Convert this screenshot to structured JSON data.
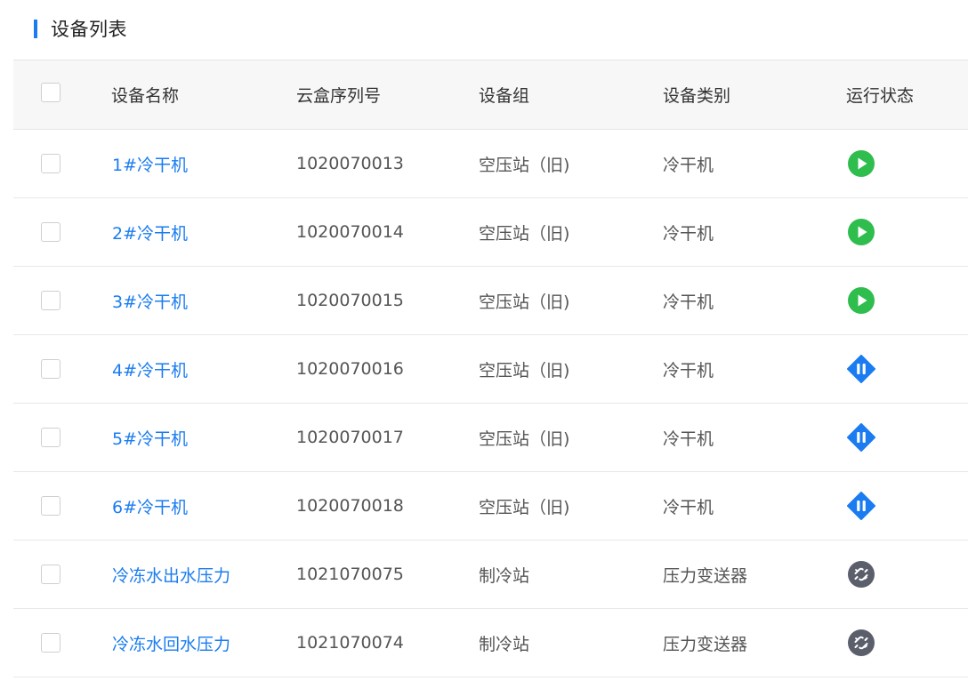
{
  "section": {
    "title": "设备列表",
    "accent_color": "#1a7cf0"
  },
  "table": {
    "columns": {
      "name": "设备名称",
      "serial": "云盒序列号",
      "group": "设备组",
      "category": "设备类别",
      "status": "运行状态"
    },
    "rows": [
      {
        "name": "1#冷干机",
        "serial": "1020070013",
        "group": "空压站（旧)",
        "category": "冷干机",
        "status": "running",
        "status_icon": "play-circle-icon"
      },
      {
        "name": "2#冷干机",
        "serial": "1020070014",
        "group": "空压站（旧)",
        "category": "冷干机",
        "status": "running",
        "status_icon": "play-circle-icon"
      },
      {
        "name": "3#冷干机",
        "serial": "1020070015",
        "group": "空压站（旧)",
        "category": "冷干机",
        "status": "running",
        "status_icon": "play-circle-icon"
      },
      {
        "name": "4#冷干机",
        "serial": "1020070016",
        "group": "空压站（旧)",
        "category": "冷干机",
        "status": "paused",
        "status_icon": "pause-diamond-icon"
      },
      {
        "name": "5#冷干机",
        "serial": "1020070017",
        "group": "空压站（旧)",
        "category": "冷干机",
        "status": "paused",
        "status_icon": "pause-diamond-icon"
      },
      {
        "name": "6#冷干机",
        "serial": "1020070018",
        "group": "空压站（旧)",
        "category": "冷干机",
        "status": "paused",
        "status_icon": "pause-diamond-icon"
      },
      {
        "name": "冷冻水出水压力",
        "serial": "1021070075",
        "group": "制冷站",
        "category": "压力变送器",
        "status": "disconnected",
        "status_icon": "disconnected-link-icon"
      },
      {
        "name": "冷冻水回水压力",
        "serial": "1021070074",
        "group": "制冷站",
        "category": "压力变送器",
        "status": "disconnected",
        "status_icon": "disconnected-link-icon"
      }
    ]
  },
  "colors": {
    "link": "#1a7cf0",
    "running": "#2fbd4e",
    "paused": "#1a7cf0",
    "disconnected": "#5b5f6b"
  }
}
